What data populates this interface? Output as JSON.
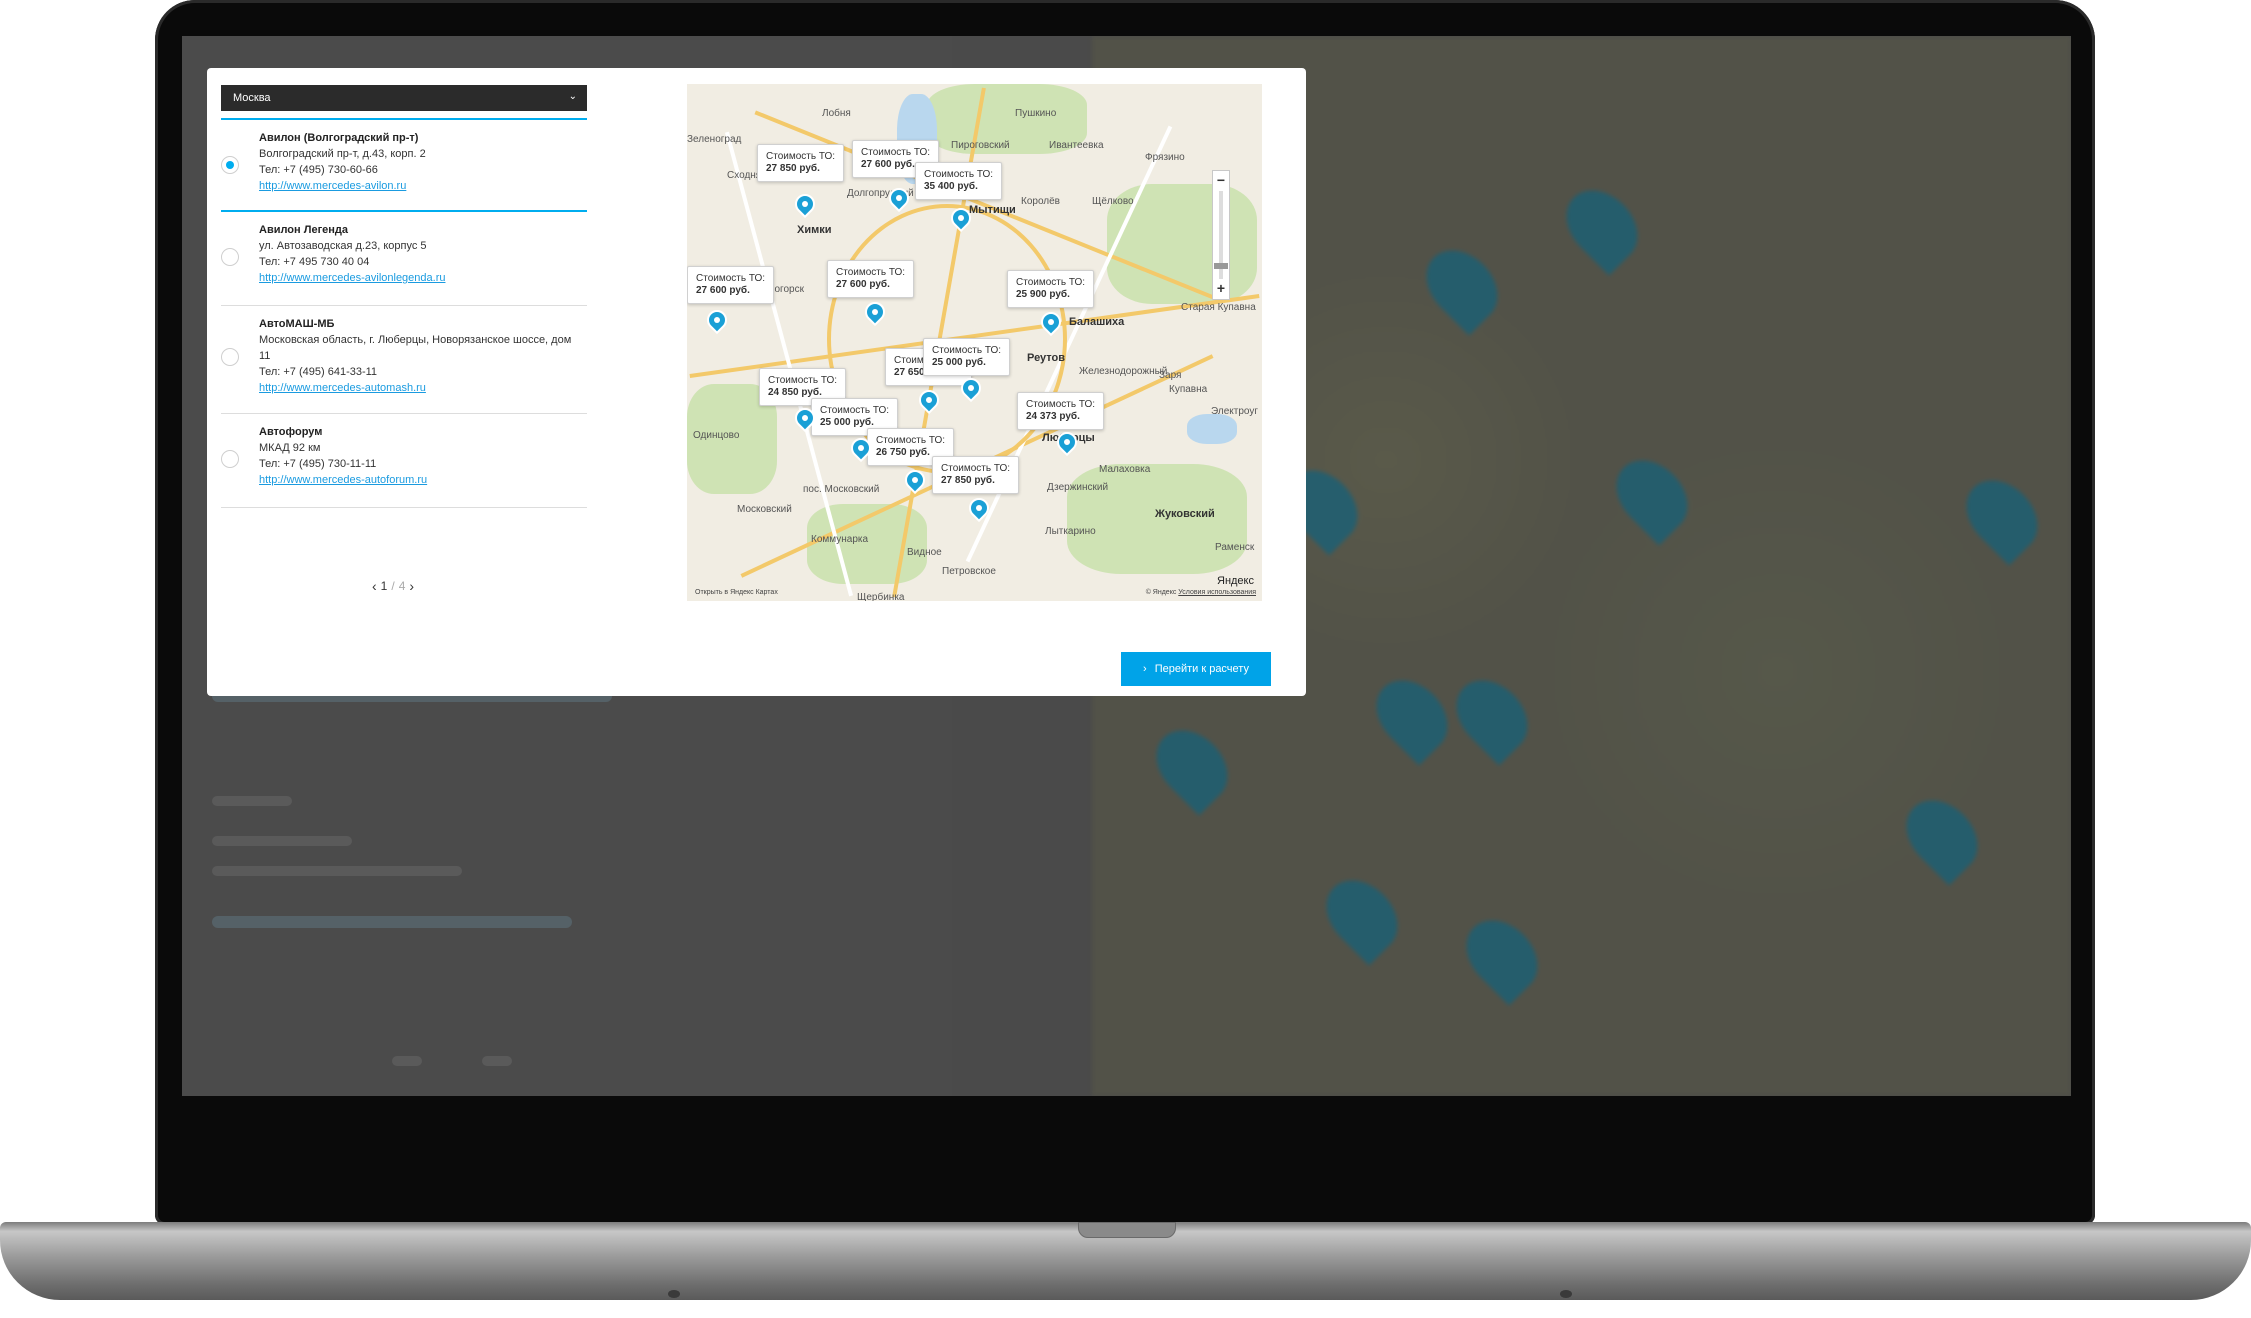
{
  "city_select": {
    "value": "Москва",
    "chevron": "⌄"
  },
  "dealers": [
    {
      "name": "Авилон (Волгоградский пр-т)",
      "address": "Волгоградский пр-т, д.43, корп. 2",
      "phone": "Тел: +7 (495) 730-60-66",
      "url": "http://www.mercedes-avilon.ru",
      "selected": true
    },
    {
      "name": "Авилон Легенда",
      "address": "ул. Автозаводская д.23, корпус 5",
      "phone": "Тел: +7 495 730 40 04",
      "url": "http://www.mercedes-avilonlegenda.ru",
      "selected": false
    },
    {
      "name": "АвтоМАШ-МБ",
      "address": "Московская область, г. Люберцы, Новорязанское шоссе, дом 11",
      "phone": "Тел: +7 (495) 641-33-11",
      "url": "http://www.mercedes-automash.ru",
      "selected": false
    },
    {
      "name": "Автофорум",
      "address": "МКАД 92 км",
      "phone": "Тел: +7 (495) 730-11-11",
      "url": "http://www.mercedes-autoforum.ru",
      "selected": false
    }
  ],
  "pager": {
    "current": "1",
    "separator": "/",
    "total": "4",
    "prev": "‹",
    "next": "›"
  },
  "map": {
    "price_label": "Стоимость ТО:",
    "prices": [
      "27 850 руб.",
      "27 600 руб.",
      "35 400 руб.",
      "27 600 руб.",
      "27 600 руб.",
      "25 900 руб.",
      "27 650",
      "25 000 руб.",
      "24 850 руб.",
      "25 000 руб.",
      "26 750 руб.",
      "27 850 руб.",
      "24 373 руб."
    ],
    "cities": [
      "Лобня",
      "Пушкино",
      "Ивантеевка",
      "Химки",
      "Мытищи",
      "Королёв",
      "Щёлково",
      "Фрязино",
      "Балашиха",
      "Реутов",
      "Железнодорожный",
      "Одинцово",
      "Люберцы",
      "Жуковский",
      "Московский",
      "Видное",
      "Лыткарино",
      "Раменск",
      "Щербинка",
      "Петровское",
      "Малаховка",
      "Купавна",
      "Электроуг",
      "Старая Купавна",
      "Заря",
      "Коммунарка",
      "пос. Московский",
      "Зеленоград",
      "Красногорск",
      "Пироговский",
      "Долгопрудный",
      "Дзержинский",
      "Сходня"
    ],
    "open_link": "Открыть в Яндекс Картах",
    "copyright": "© Яндекс",
    "terms": "Условия использования",
    "brand": "Яндекс",
    "zoom_in": "+",
    "zoom_out": "−"
  },
  "go_button": {
    "label": "Перейти к расчету",
    "icon": "›"
  }
}
